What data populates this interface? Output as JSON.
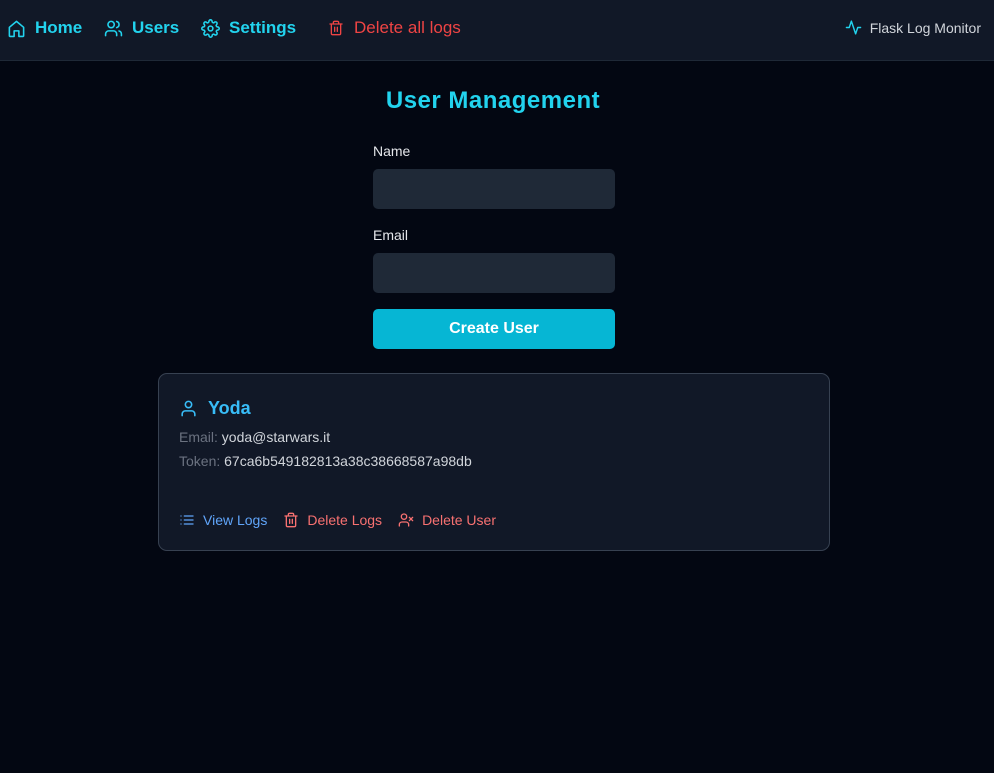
{
  "nav": {
    "home_label": "Home",
    "users_label": "Users",
    "settings_label": "Settings",
    "delete_all_logs_label": "Delete all logs",
    "brand_label": "Flask Log Monitor"
  },
  "page": {
    "title": "User Management"
  },
  "form": {
    "name_label": "Name",
    "name_value": "",
    "email_label": "Email",
    "email_value": "",
    "submit_label": "Create User"
  },
  "users": [
    {
      "name": "Yoda",
      "email_label": "Email:",
      "email": "yoda@starwars.it",
      "token_label": "Token:",
      "token": "67ca6b549182813a38c38668587a98db",
      "actions": {
        "view_logs": "View Logs",
        "delete_logs": "Delete Logs",
        "delete_user": "Delete User"
      }
    }
  ],
  "colors": {
    "background": "#030712",
    "navbar": "#111827",
    "accent": "#22d3ee",
    "primary_button": "#06b6d4",
    "danger": "#ef4444",
    "link": "#60a5fa"
  },
  "icons": {
    "home": "home-icon",
    "users": "users-icon",
    "settings": "gear-icon",
    "delete_all": "trash-icon",
    "brand": "activity-icon",
    "user": "user-icon",
    "view_logs": "list-icon",
    "delete_logs": "trash-icon",
    "delete_user": "user-x-icon"
  }
}
